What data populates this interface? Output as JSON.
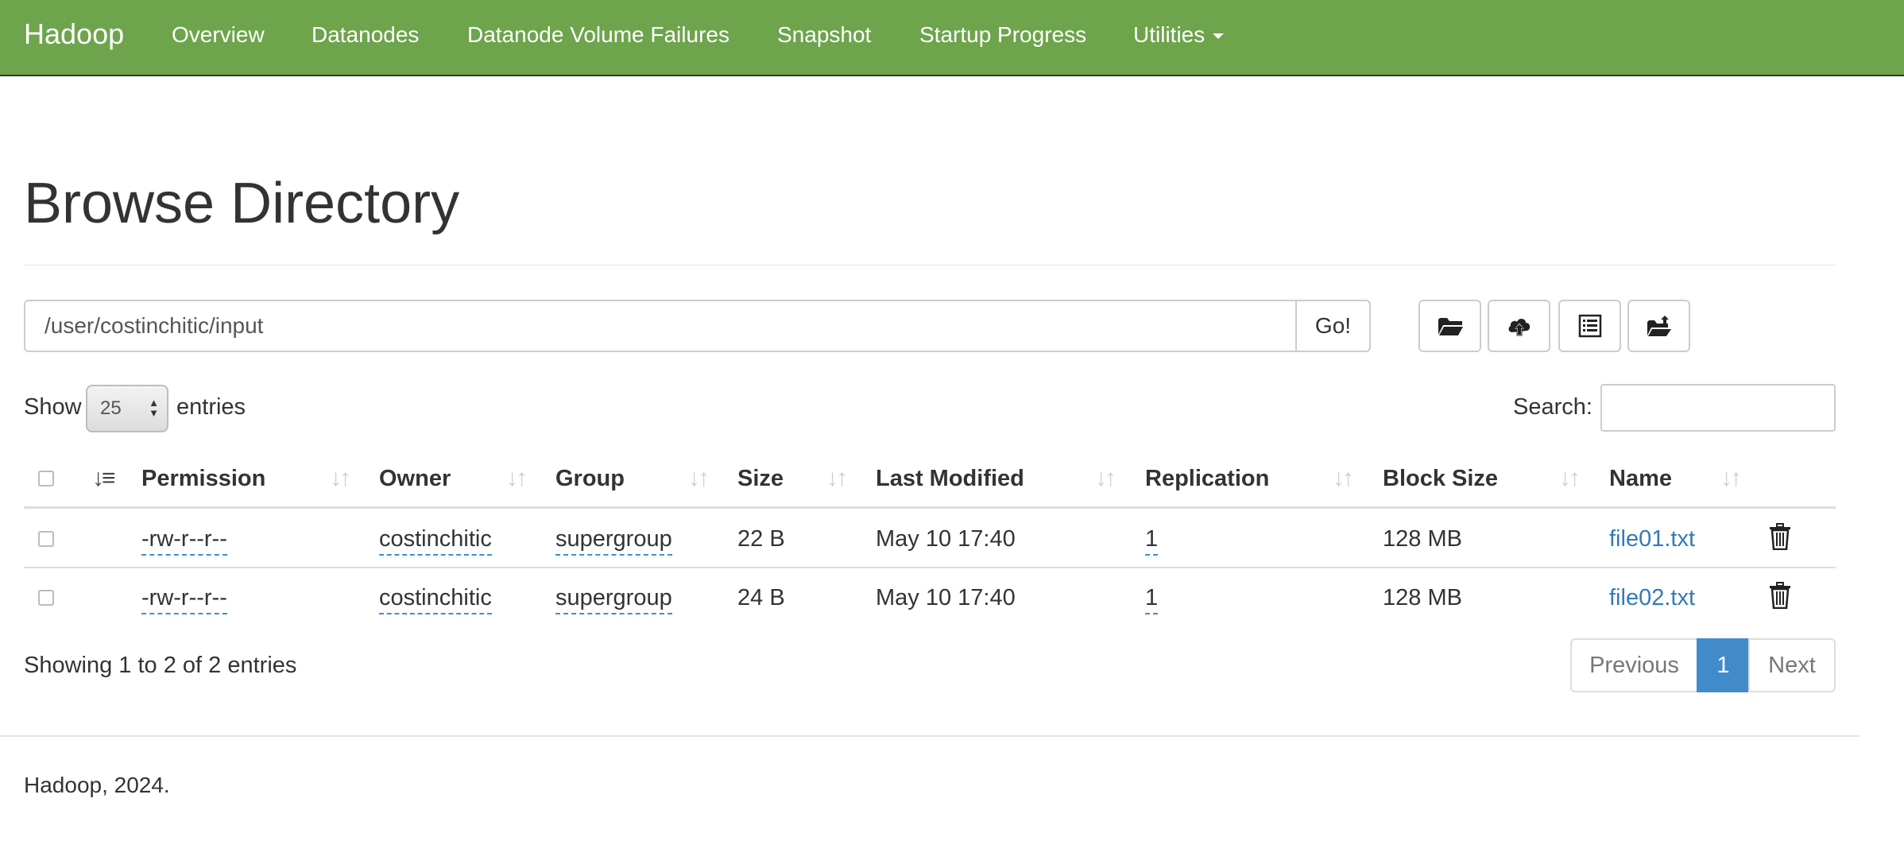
{
  "navbar": {
    "brand": "Hadoop",
    "items": [
      "Overview",
      "Datanodes",
      "Datanode Volume Failures",
      "Snapshot",
      "Startup Progress",
      "Utilities"
    ],
    "color": "#6ea44c"
  },
  "page": {
    "title": "Browse Directory"
  },
  "path_bar": {
    "value": "/user/costinchitic/input",
    "go_label": "Go!"
  },
  "toolbar": {
    "icons": [
      "folder-open-icon",
      "cloud-upload-icon",
      "list-alt-icon",
      "move-folder-icon"
    ]
  },
  "table_controls": {
    "show_label": "Show",
    "entries_value": "25",
    "entries_label": "entries",
    "search_label": "Search:"
  },
  "table": {
    "columns": [
      "Permission",
      "Owner",
      "Group",
      "Size",
      "Last Modified",
      "Replication",
      "Block Size",
      "Name"
    ],
    "rows": [
      {
        "permission": "-rw-r--r--",
        "owner": "costinchitic",
        "group": "supergroup",
        "size": "22 B",
        "last_modified": "May 10 17:40",
        "replication": "1",
        "block_size": "128 MB",
        "name": "file01.txt"
      },
      {
        "permission": "-rw-r--r--",
        "owner": "costinchitic",
        "group": "supergroup",
        "size": "24 B",
        "last_modified": "May 10 17:40",
        "replication": "1",
        "block_size": "128 MB",
        "name": "file02.txt"
      }
    ]
  },
  "summary": "Showing 1 to 2 of 2 entries",
  "pagination": {
    "previous": "Previous",
    "current": "1",
    "next": "Next",
    "active_color": "#428bca"
  },
  "footer": "Hadoop, 2024."
}
